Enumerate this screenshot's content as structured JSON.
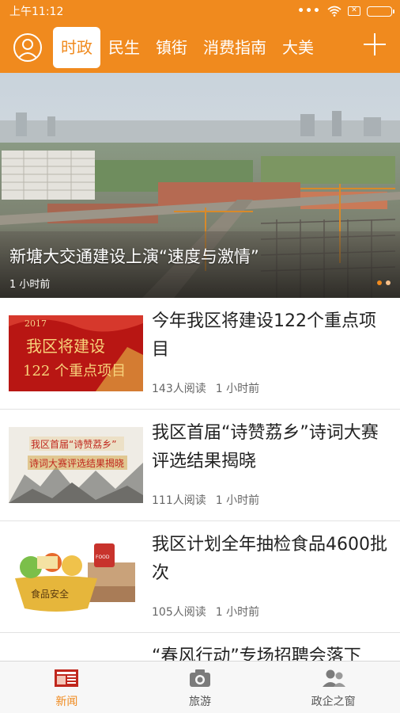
{
  "status_bar": {
    "time": "上午11:12",
    "dots": "•••",
    "sim_mark": "✕"
  },
  "nav": {
    "tabs": [
      {
        "label": "时政",
        "active": true
      },
      {
        "label": "民生",
        "active": false
      },
      {
        "label": "镇街",
        "active": false
      },
      {
        "label": "消费指南",
        "active": false
      },
      {
        "label": "大美",
        "active": false
      }
    ]
  },
  "hero": {
    "title": "新塘大交通建设上演“速度与激情”",
    "time": "1 小时前",
    "slides": 2,
    "active_slide": 1
  },
  "news": [
    {
      "title": "今年我区将建设122个重点项目",
      "reads": "143人阅读",
      "time": "1 小时前",
      "thumb_lines": [
        "2017",
        "我区将建设",
        "122 个重点项目"
      ]
    },
    {
      "title": "我区首届“诗赞荔乡”诗词大赛评选结果揭晓",
      "reads": "111人阅读",
      "time": "1 小时前",
      "thumb_lines": [
        "我区首届“诗赞荔乡”",
        "诗词大赛评选结果揭晓"
      ]
    },
    {
      "title": "我区计划全年抽检食品4600批次",
      "reads": "105人阅读",
      "time": "1 小时前",
      "thumb_lines": [
        "食品安全"
      ]
    },
    {
      "title": "“春风行动”专场招聘会落下",
      "reads": "",
      "time": ""
    }
  ],
  "bottom_tabs": [
    {
      "label": "新闻",
      "icon": "newspaper-icon",
      "active": true
    },
    {
      "label": "旅游",
      "icon": "camera-icon",
      "active": false
    },
    {
      "label": "政企之窗",
      "icon": "people-icon",
      "active": false
    }
  ],
  "colors": {
    "accent": "#f08a1e",
    "text": "#222222",
    "meta": "#666666"
  }
}
